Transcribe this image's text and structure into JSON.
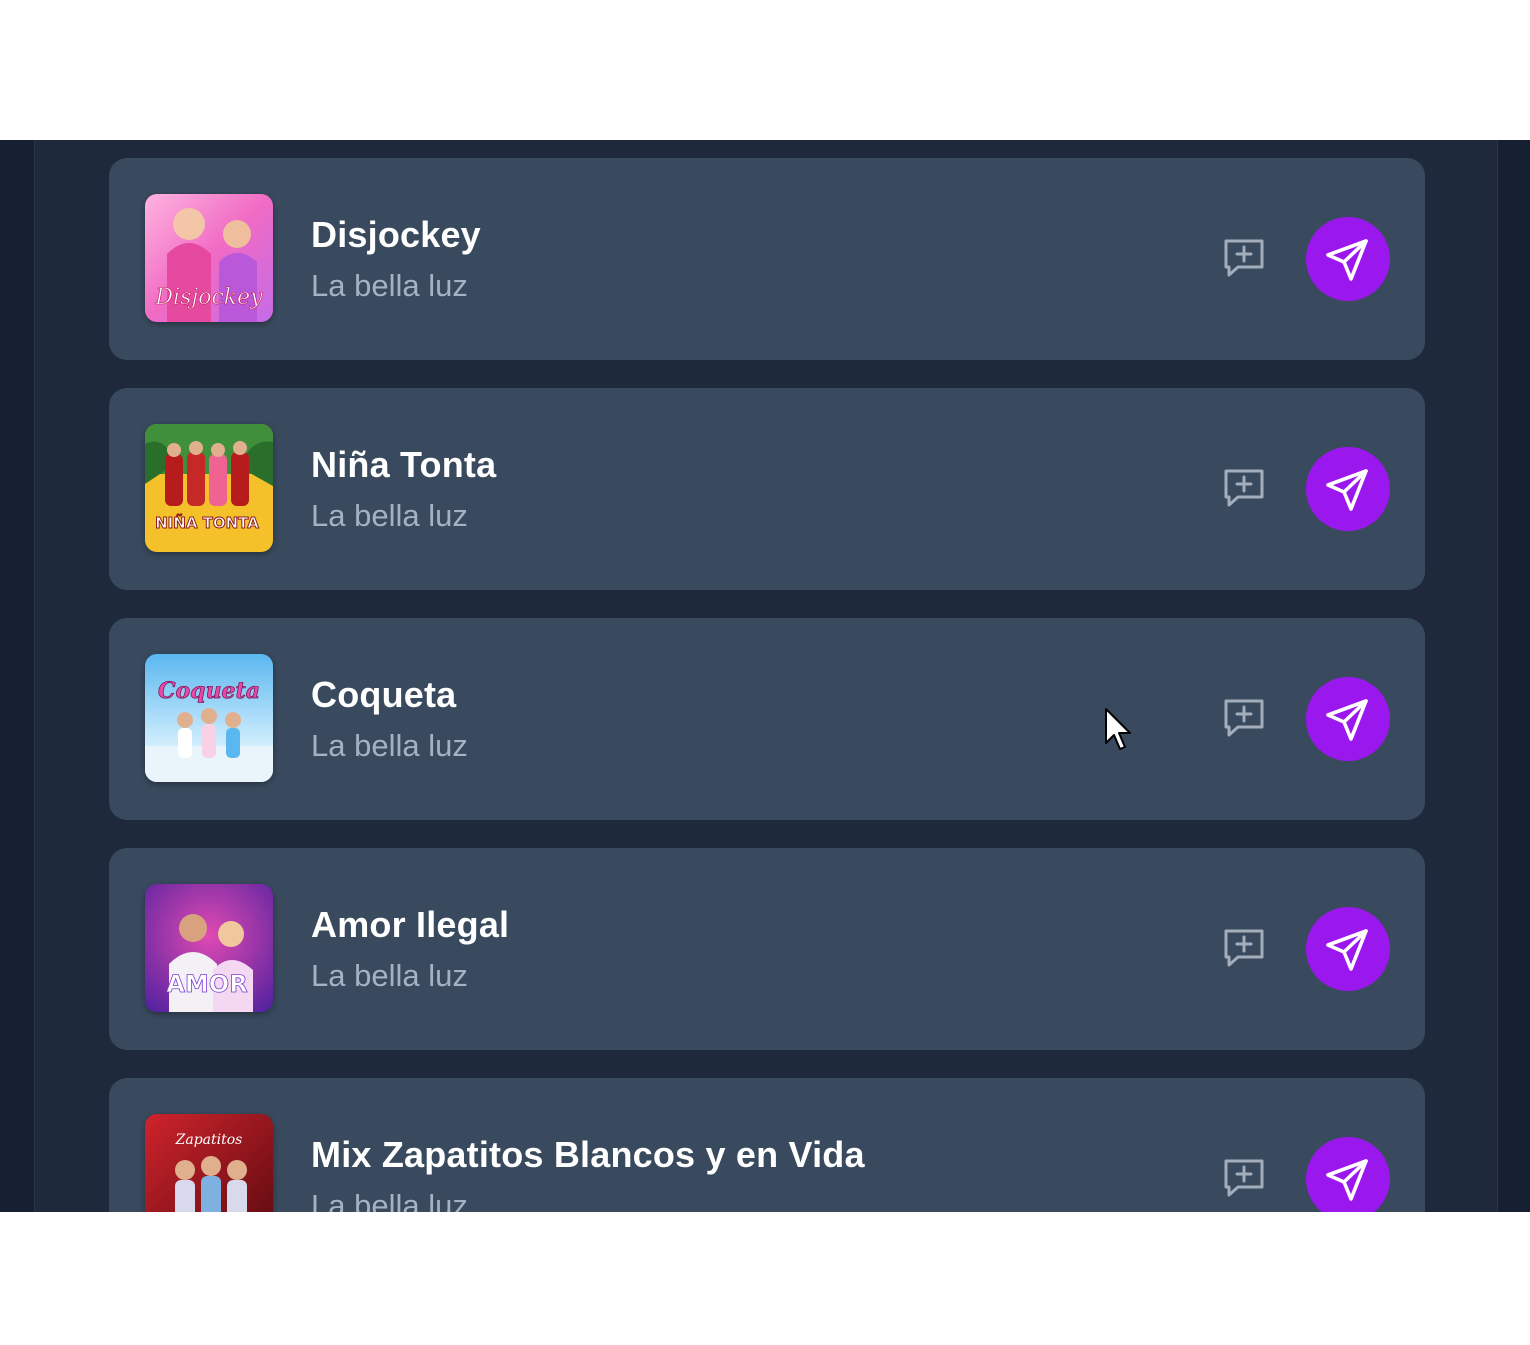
{
  "songs": [
    {
      "title": "Disjockey",
      "artist": "La bella luz",
      "cover_text": "Disjockey",
      "cover_colors": [
        "#f06bc4",
        "#c46be8",
        "#ffb3e0"
      ]
    },
    {
      "title": "Niña Tonta",
      "artist": "La bella luz",
      "cover_text": "NIÑA TONTA",
      "cover_colors": [
        "#f4c12a",
        "#2f7d32",
        "#b71c1c"
      ]
    },
    {
      "title": "Coqueta",
      "artist": "La bella luz",
      "cover_text": "Coqueta",
      "cover_colors": [
        "#5ab7f0",
        "#bfe6fb",
        "#e84aa8"
      ]
    },
    {
      "title": "Amor Ilegal",
      "artist": "La bella luz",
      "cover_text": "AMOR",
      "cover_colors": [
        "#7b3fd6",
        "#e04ab2",
        "#f4d7f0"
      ]
    },
    {
      "title": "Mix Zapatitos Blancos y en Vida",
      "artist": "La bella luz",
      "cover_text": "Zapatitos",
      "cover_colors": [
        "#b3151e",
        "#5a0a0f",
        "#d9d9ee"
      ]
    }
  ],
  "icons": {
    "add": "message-square-plus-icon",
    "send": "send-icon"
  },
  "colors": {
    "accent": "#9a17ee",
    "card": "#394a5e",
    "background": "#1e293b"
  }
}
